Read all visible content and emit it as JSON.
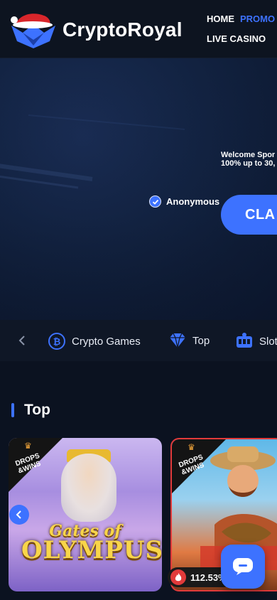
{
  "brand": {
    "name": "CryptoRoyal"
  },
  "nav": {
    "items": [
      {
        "label": "HOME"
      },
      {
        "label": "PROMO"
      },
      {
        "label": "LIVE CASINO"
      }
    ]
  },
  "hero": {
    "welcome_line1": "Welcome Spor",
    "welcome_line2": "100% up to 30,",
    "anonymous_label": "Anonymous",
    "claim_button": "CLA"
  },
  "categories": {
    "items": [
      {
        "label": "Crypto Games",
        "icon": "bitcoin-icon"
      },
      {
        "label": "Top",
        "icon": "diamond-icon"
      },
      {
        "label": "Slot",
        "icon": "slot-machine-icon"
      }
    ]
  },
  "section": {
    "title": "Top"
  },
  "games": [
    {
      "title_line1": "Gates of",
      "title_line2": "OLYMPUS",
      "badge": "DROPS &WINS"
    },
    {
      "badge": "DROPS &WINS",
      "rtp": "112.53%"
    }
  ],
  "colors": {
    "accent": "#3d72ff",
    "background": "#0b1220",
    "hot": "#e23a3a"
  }
}
